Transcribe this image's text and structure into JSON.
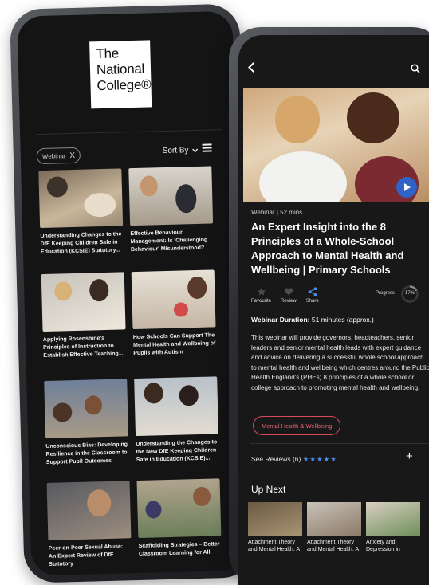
{
  "left": {
    "logo_lines": [
      "The",
      "National",
      "College®"
    ],
    "filter_chip": {
      "label": "Webinar",
      "close": "X"
    },
    "sort_label": "Sort By",
    "cards": [
      {
        "title": "Understanding Changes to the DfE Keeping Children Safe in Education (KCSIE) Statutory..."
      },
      {
        "title": "Effective Behaviour Management: Is 'Challenging Behaviour' Misunderstood?"
      },
      {
        "title": "Applying Rosenshine's Principles of Instruction to Establish Effective Teaching..."
      },
      {
        "title": "How Schools Can Support The Mental Health and Wellbeing of Pupils with Autism"
      },
      {
        "title": "Unconscious Bias: Developing Resilience in the Classroom to Support Pupil Outcomes"
      },
      {
        "title": "Understanding the Changes to the New DfE Keeping Children Safe in Education (KCSIE)..."
      },
      {
        "title": "Peer-on-Peer Sexual Abuse: An Expert Review of DfE Statutory"
      },
      {
        "title": "Scaffolding Strategies – Better Classroom Learning for All"
      }
    ]
  },
  "right": {
    "meta": "Webinar |  52 mins",
    "title": "An Expert Insight into the 8 Principles of a Whole-School Approach to Mental Health and Wellbeing | Primary Schools",
    "actions": [
      {
        "label": "Favourite",
        "icon": "star-icon"
      },
      {
        "label": "Review",
        "icon": "heart-icon"
      },
      {
        "label": "Share",
        "icon": "share-icon"
      }
    ],
    "progress_label": "Progress",
    "progress_value": "17%",
    "progress_fraction": 0.17,
    "duration_label": "Webinar Duration:",
    "duration_value": " 51 minutes (approx.)",
    "description": "This webinar will provide governors, headteachers, senior leaders and senior mental health leads with expert guidance and advice on delivering a successful whole school approach to mental health and wellbeing which centres around the Public Health England's (PHEs) 8 principles of a whole school or college approach to promoting mental health and wellbeing.",
    "tag": "Mental Health & Wellbeing",
    "reviews_label": "See Reviews (6)",
    "stars": "★★★★★",
    "plus": "+",
    "up_next_label": "Up Next",
    "up_next": [
      {
        "title": "Attachment Theory and Mental Health: A"
      },
      {
        "title": "Attachment Theory and Mental Health: A"
      },
      {
        "title": "Anxiety and Depression in"
      }
    ],
    "colors": {
      "accent": "#2f63c8",
      "tag": "#d94a5a",
      "stars": "#4a8df0"
    }
  }
}
